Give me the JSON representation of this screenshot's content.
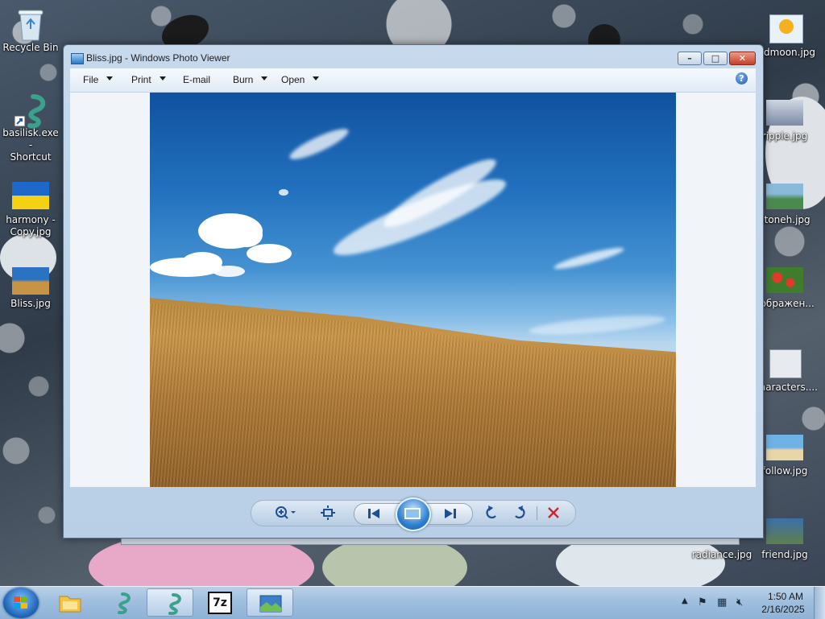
{
  "desktop": {
    "icons_left": [
      {
        "name": "recycle-bin",
        "label": "Recycle Bin"
      },
      {
        "name": "basilisk-shortcut",
        "label": "basilisk.exe - Shortcut",
        "line1": "basilisk.exe -",
        "line2": "Shortcut"
      },
      {
        "name": "harmony-copy",
        "label": "harmony - Copy.jpg",
        "line1": "harmony -",
        "line2": "Copy.jpg"
      },
      {
        "name": "bliss",
        "label": "Bliss.jpg"
      }
    ],
    "icons_right": [
      {
        "name": "redmoon",
        "label": "redmoon.jpg"
      },
      {
        "name": "ripple",
        "label": "ripple.jpg"
      },
      {
        "name": "stoneh",
        "label": "stoneh.jpg"
      },
      {
        "name": "zobrazhen",
        "label": "зображен..."
      },
      {
        "name": "characters",
        "label": "characters...."
      },
      {
        "name": "follow",
        "label": "follow.jpg"
      },
      {
        "name": "friend",
        "label": "friend.jpg"
      },
      {
        "name": "radiance",
        "label": "radiance.jpg"
      }
    ]
  },
  "window": {
    "title": "Bliss.jpg - Windows Photo Viewer",
    "menu": {
      "file": "File",
      "print": "Print",
      "email": "E-mail",
      "burn": "Burn",
      "open": "Open"
    },
    "help_symbol": "?"
  },
  "controls": {
    "zoom": "zoom-icon",
    "fit": "actual-size-icon",
    "previous": "previous-icon",
    "slideshow": "slideshow-icon",
    "next": "next-icon",
    "rotate_ccw": "rotate-counterclockwise-icon",
    "rotate_cw": "rotate-clockwise-icon",
    "delete": "delete-icon"
  },
  "taskbar": {
    "pinned": [
      "explorer",
      "basilisk",
      "basilisk-active",
      "7-zip",
      "photo-viewer"
    ],
    "sevenzip_label": "7z",
    "clock": {
      "time": "1:50 AM",
      "date": "2/16/2025"
    }
  },
  "colors": {
    "accent": "#1e4f8f",
    "close": "#c4402a",
    "taskbar": "#9fbfdf"
  }
}
